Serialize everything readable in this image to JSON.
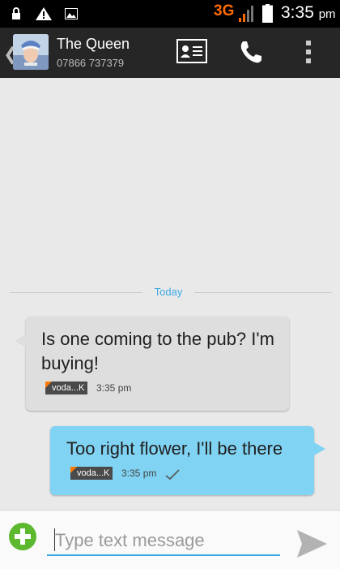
{
  "status_bar": {
    "network_type": "3G",
    "time": "3:35",
    "time_suffix": "pm",
    "icons": [
      "lock-icon",
      "warning-icon",
      "image-icon",
      "signal-icon",
      "battery-icon"
    ],
    "network_color": "#ff6a00"
  },
  "header": {
    "contact_name": "The Queen",
    "contact_number": "07866 737379",
    "icons": [
      "back-chevron-icon",
      "contact-avatar",
      "contact-card-icon",
      "phone-icon",
      "overflow-menu-icon"
    ],
    "background": "#262626"
  },
  "conversation": {
    "date_label": "Today",
    "date_color": "#3aa9e3",
    "messages": [
      {
        "direction": "incoming",
        "text": "Is one coming to the pub? I'm buying!",
        "carrier": "voda...K",
        "time": "3:35 pm",
        "bubble_color": "#dedede"
      },
      {
        "direction": "outgoing",
        "text": "Too right flower, I'll be there",
        "carrier": "voda...K",
        "time": "3:35 pm",
        "delivered": true,
        "bubble_color": "#80d3f2"
      }
    ]
  },
  "composer": {
    "placeholder": "Type text message",
    "value": "",
    "add_icon": "add-attachment-icon",
    "send_icon": "send-icon",
    "add_color": "#5cb82e"
  }
}
